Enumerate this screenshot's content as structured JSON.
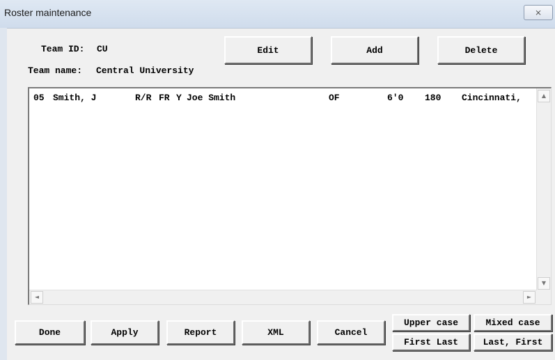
{
  "window": {
    "title": "Roster maintenance",
    "close_icon_glyph": "⨯"
  },
  "header": {
    "team_id_label": "Team ID:",
    "team_id_value": "CU",
    "team_name_label": "Team name:",
    "team_name_value": "Central University"
  },
  "top_buttons": {
    "edit": "Edit",
    "add": "Add",
    "delete": "Delete"
  },
  "roster": {
    "rows": [
      {
        "number": "05",
        "name": "Smith, J",
        "bats_throws": "R/R",
        "class": "FR",
        "flag": "Y",
        "full_name": "Joe Smith",
        "position": "OF",
        "height": "6'0",
        "weight": "180",
        "hometown": "Cincinnati,"
      }
    ]
  },
  "scroll": {
    "up": "▲",
    "down": "▼",
    "left": "◄",
    "right": "►"
  },
  "bottom_buttons": {
    "done": "Done",
    "apply": "Apply",
    "report": "Report",
    "xml": "XML",
    "cancel": "Cancel",
    "upper_case": "Upper case",
    "mixed_case": "Mixed case",
    "first_last": "First Last",
    "last_first": "Last, First"
  }
}
